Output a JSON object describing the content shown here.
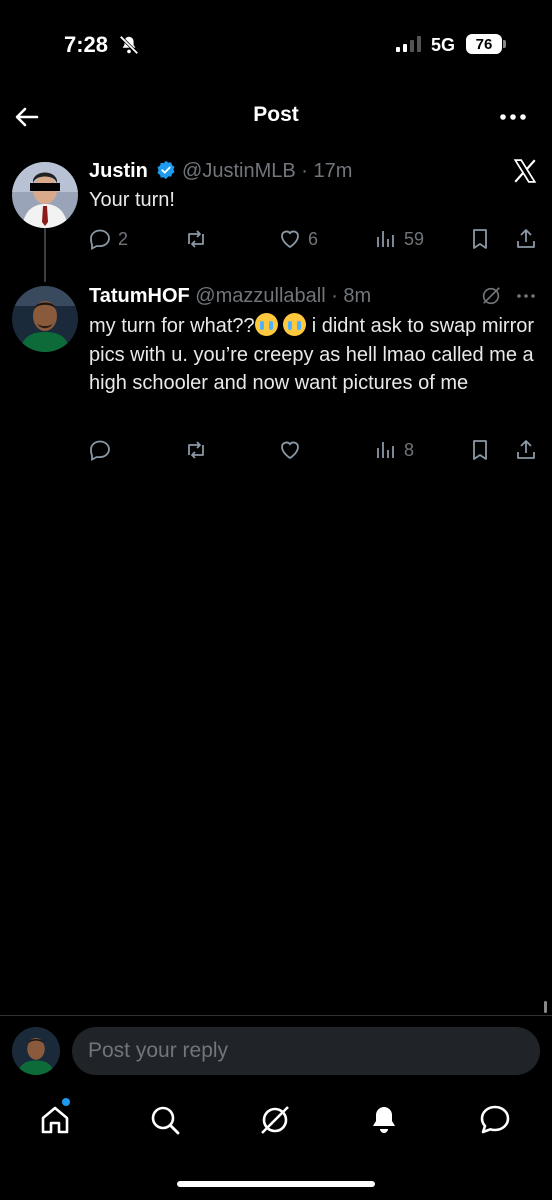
{
  "status_bar": {
    "time": "7:28",
    "network": "5G",
    "battery": "76"
  },
  "header": {
    "title": "Post"
  },
  "tweets": [
    {
      "name": "Justin",
      "handle": "@JustinMLB",
      "time": "· 17m",
      "text": "Your turn!",
      "verified": true,
      "actions": {
        "replies": "2",
        "reposts": "",
        "likes": "6",
        "views": "59"
      }
    },
    {
      "name": "TatumHOF",
      "handle": "@mazzullaball",
      "time": "· 8m",
      "text_before_emoji": "my turn for what??",
      "text_after_emoji": " i didnt ask to swap mirror pics with u. you’re creepy as hell lmao called me a high schooler and now want pictures of me",
      "emoji": [
        "loudly-crying-face",
        "loudly-crying-face"
      ],
      "actions": {
        "replies": "",
        "reposts": "",
        "likes": "",
        "views": "8"
      }
    }
  ],
  "reply_box": {
    "placeholder": "Post your reply"
  },
  "nav": {
    "items": [
      "home-icon",
      "search-icon",
      "grok-icon",
      "notifications-icon",
      "messages-icon"
    ],
    "home_has_badge": true
  },
  "colors": {
    "accent": "#1d9bf0",
    "muted": "#71767b",
    "background": "#000000"
  }
}
